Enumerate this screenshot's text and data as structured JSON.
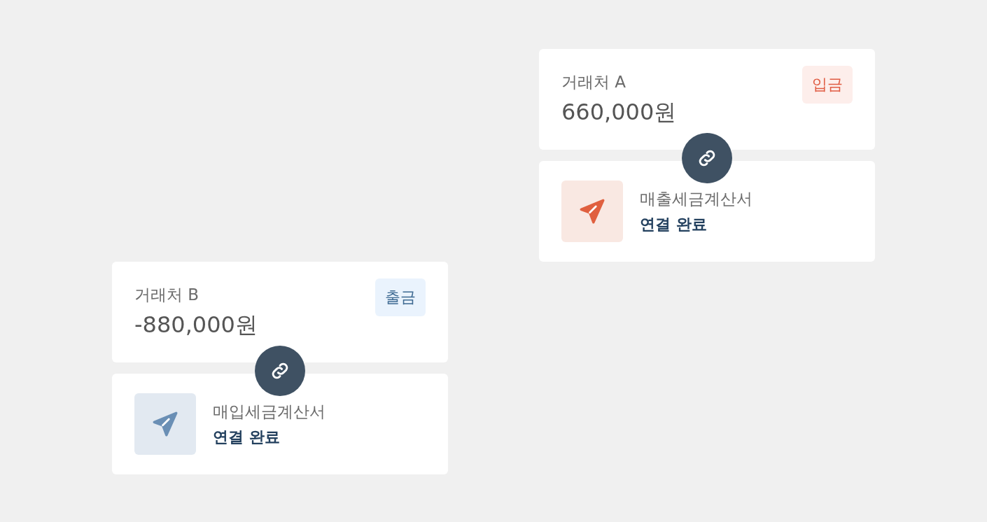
{
  "transactions": [
    {
      "kind": "withdrawal",
      "party": "거래처 B",
      "amount": "-880,000원",
      "badge": "출금",
      "document": {
        "title": "매입세금계산서",
        "status": "연결 완료"
      }
    },
    {
      "kind": "deposit",
      "party": "거래처 A",
      "amount": "660,000원",
      "badge": "입금",
      "document": {
        "title": "매출세금계산서",
        "status": "연결 완료"
      }
    }
  ]
}
